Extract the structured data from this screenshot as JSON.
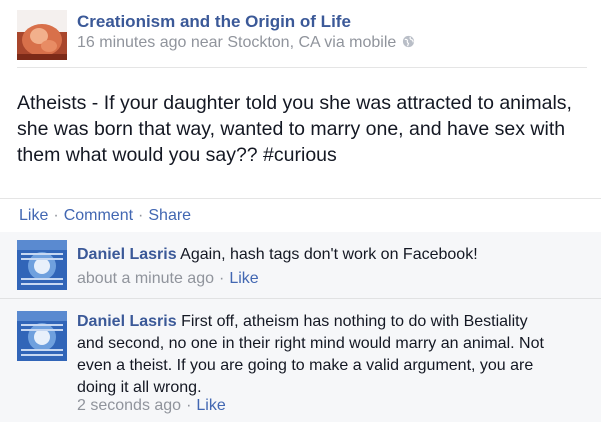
{
  "post": {
    "page_name": "Creationism and the Origin of Life",
    "meta": "16 minutes ago near Stockton, CA via mobile",
    "privacy_icon": "globe-icon",
    "text": "Atheists - If your daughter told you she was attracted to animals, she was born that way, wanted to marry one, and have sex with them what would you say?? #curious"
  },
  "actions": {
    "like": "Like",
    "comment": "Comment",
    "share": "Share",
    "separator": "·"
  },
  "comments": [
    {
      "author": "Daniel Lasris",
      "text": "Again, hash tags don't work on Facebook!",
      "time": "about a minute ago",
      "like": "Like"
    },
    {
      "author": "Daniel Lasris",
      "text": "First off, atheism has nothing to do with Bestiality and second, no one in their right mind would marry an animal. Not even a theist. If you are going to make a valid argument, you are doing it all wrong.",
      "time": "2 seconds ago",
      "like": "Like"
    }
  ],
  "colors": {
    "link": "#3b5998",
    "action_link": "#4267b2",
    "meta": "#90949c",
    "comment_bg": "#f6f7f9"
  }
}
